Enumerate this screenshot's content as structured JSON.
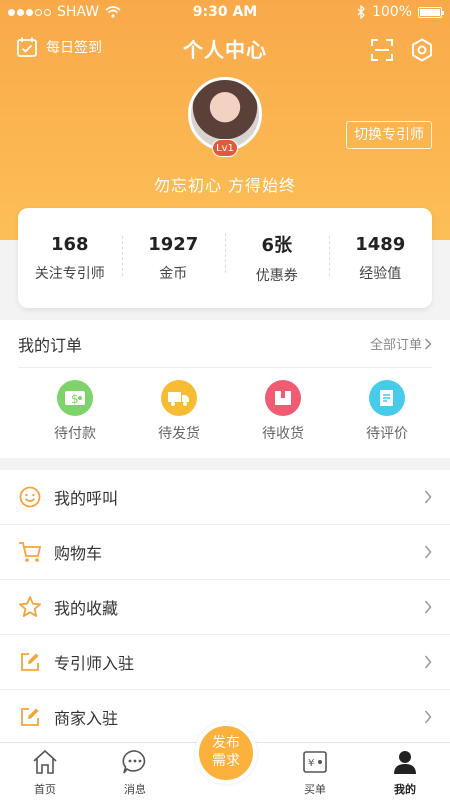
{
  "status": {
    "carrier": "SHAW",
    "time": "9:30 AM",
    "battery": "100%"
  },
  "nav": {
    "checkin": "每日签到",
    "title": "个人中心"
  },
  "profile": {
    "level": "Lv1",
    "switch": "切换专引师",
    "motto": "勿忘初心 方得始终"
  },
  "stats": [
    {
      "num": "168",
      "label": "关注专引师"
    },
    {
      "num": "1927",
      "label": "金币"
    },
    {
      "num": "6张",
      "label": "优惠券"
    },
    {
      "num": "1489",
      "label": "经验值"
    }
  ],
  "orders": {
    "title": "我的订单",
    "all": "全部订单",
    "items": [
      {
        "label": "待付款",
        "icon": "wallet-icon",
        "color": "#7fd36b"
      },
      {
        "label": "待发货",
        "icon": "truck-icon",
        "color": "#f7bc33"
      },
      {
        "label": "待收货",
        "icon": "box-icon",
        "color": "#f25c72"
      },
      {
        "label": "待评价",
        "icon": "review-icon",
        "color": "#46cbe8"
      }
    ]
  },
  "menu": [
    {
      "label": "我的呼叫",
      "icon": "smile-icon"
    },
    {
      "label": "购物车",
      "icon": "cart-icon"
    },
    {
      "label": "我的收藏",
      "icon": "star-icon"
    },
    {
      "label": "专引师入驻",
      "icon": "edit-icon"
    },
    {
      "label": "商家入驻",
      "icon": "edit-icon"
    }
  ],
  "tabs": [
    {
      "label": "首页",
      "icon": "home-icon"
    },
    {
      "label": "消息",
      "icon": "message-icon"
    },
    {
      "label": "买单",
      "icon": "pay-icon"
    },
    {
      "label": "我的",
      "icon": "user-icon"
    }
  ],
  "publish": {
    "line1": "发布",
    "line2": "需求"
  },
  "colors": {
    "accent": "#fba84a",
    "menu_icon": "#f6a43a"
  }
}
